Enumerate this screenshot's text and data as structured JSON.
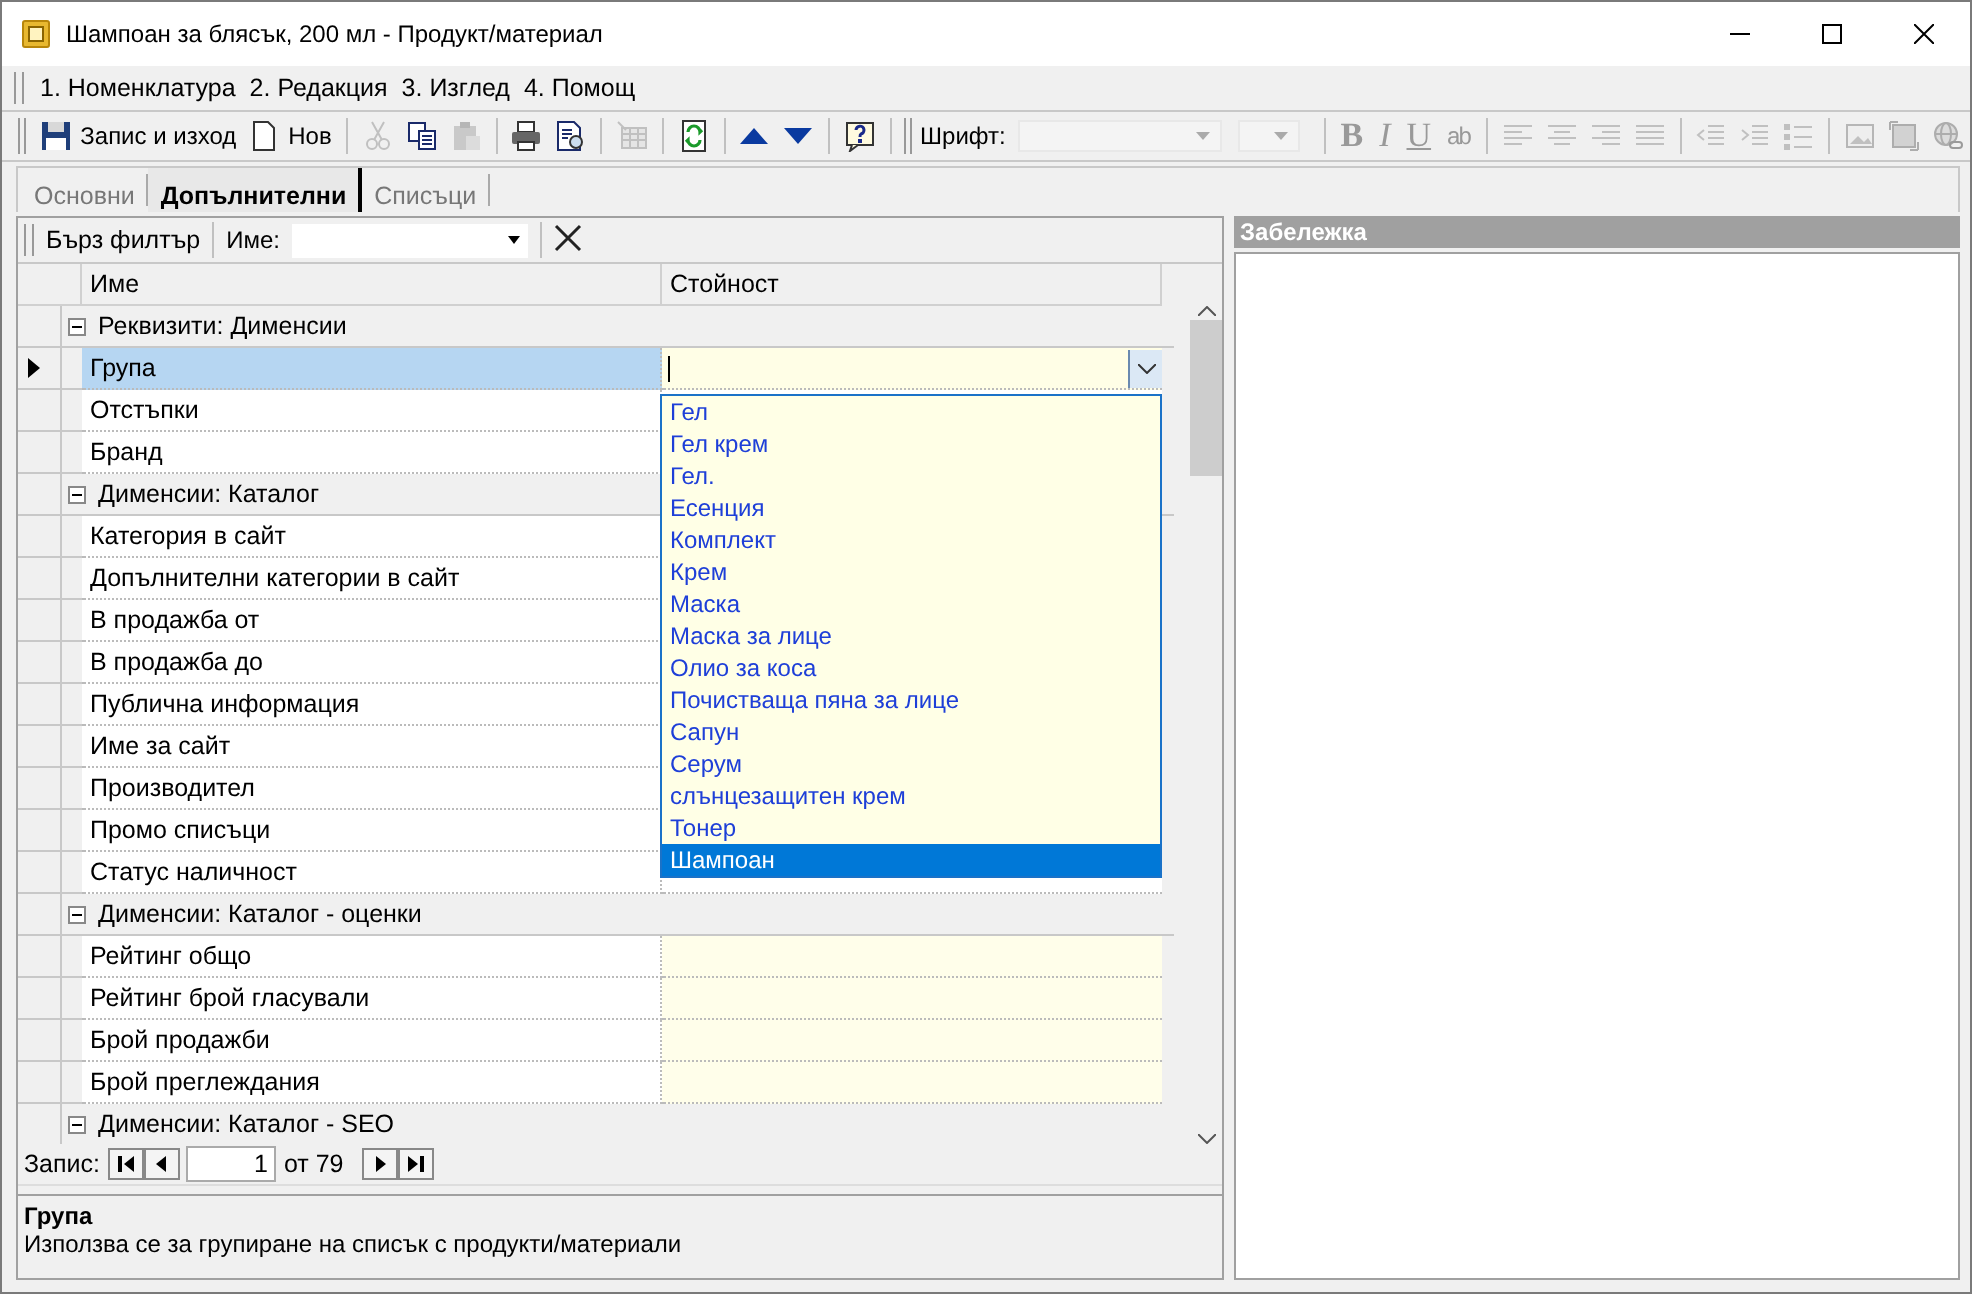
{
  "window": {
    "title": "Шампоан за блясък, 200 мл - Продукт/материал"
  },
  "menu": [
    {
      "label": "1. Номенклатура"
    },
    {
      "label": "2. Редакция"
    },
    {
      "label": "3. Изглед"
    },
    {
      "label": "4. Помощ"
    }
  ],
  "toolbar": [
    {
      "kind": "save",
      "label": "Запис и изход",
      "disabled": false
    },
    {
      "kind": "new",
      "label": "Нов",
      "disabled": false
    },
    {
      "kind": "sep"
    },
    {
      "kind": "cut",
      "disabled": true
    },
    {
      "kind": "copy",
      "disabled": false
    },
    {
      "kind": "paste",
      "disabled": true
    },
    {
      "kind": "sep"
    },
    {
      "kind": "print",
      "disabled": false
    },
    {
      "kind": "preview",
      "disabled": false
    },
    {
      "kind": "sep"
    },
    {
      "kind": "table",
      "disabled": true
    },
    {
      "kind": "sep"
    },
    {
      "kind": "refresh",
      "disabled": false
    },
    {
      "kind": "sep"
    },
    {
      "kind": "up",
      "disabled": false
    },
    {
      "kind": "down",
      "disabled": false
    },
    {
      "kind": "sep"
    },
    {
      "kind": "help",
      "disabled": false
    },
    {
      "kind": "grip"
    },
    {
      "kind": "label",
      "label": "Шрифт:"
    },
    {
      "kind": "combo",
      "disabled": true
    },
    {
      "kind": "combo",
      "disabled": true
    },
    {
      "kind": "sep"
    },
    {
      "kind": "bold",
      "label": "B",
      "disabled": true
    },
    {
      "kind": "italic",
      "label": "I",
      "disabled": true
    },
    {
      "kind": "underline",
      "label": "U",
      "disabled": true
    },
    {
      "kind": "strike",
      "label": "ab",
      "disabled": true
    },
    {
      "kind": "sep"
    },
    {
      "kind": "align-left",
      "disabled": true
    },
    {
      "kind": "align-center",
      "disabled": true
    },
    {
      "kind": "align-right",
      "disabled": true
    },
    {
      "kind": "align-justify",
      "disabled": true
    },
    {
      "kind": "sep"
    },
    {
      "kind": "outdent",
      "disabled": true
    },
    {
      "kind": "indent",
      "disabled": true
    },
    {
      "kind": "list",
      "disabled": true
    },
    {
      "kind": "sep"
    },
    {
      "kind": "image",
      "disabled": true
    },
    {
      "kind": "image-frame",
      "disabled": true
    },
    {
      "kind": "link",
      "disabled": true
    }
  ],
  "tabs": [
    {
      "label": "Основни",
      "selected": false
    },
    {
      "label": "Допълнителни",
      "selected": true
    },
    {
      "label": "Списъци",
      "selected": false
    }
  ],
  "filter": {
    "button": "Бърз филтър",
    "label": "Име:"
  },
  "grid": {
    "columns": [
      "Име",
      "Стойност"
    ],
    "rows": [
      {
        "kind": "group",
        "label": "Реквизити: Дименсии",
        "expanded": true
      },
      {
        "kind": "item",
        "name": "Група",
        "selected": true
      },
      {
        "kind": "item",
        "name": "Отстъпки",
        "selected": false
      },
      {
        "kind": "item",
        "name": "Бранд",
        "selected": false
      },
      {
        "kind": "group",
        "label": "Дименсии: Каталог",
        "expanded": true
      },
      {
        "kind": "item",
        "name": "Категория в сайт",
        "selected": false
      },
      {
        "kind": "item",
        "name": "Допълнителни категории в сайт",
        "selected": false
      },
      {
        "kind": "item",
        "name": "В продажба от",
        "selected": false
      },
      {
        "kind": "item",
        "name": "В продажба до",
        "selected": false
      },
      {
        "kind": "item",
        "name": "Публична информация",
        "selected": false
      },
      {
        "kind": "item",
        "name": "Име за сайт",
        "selected": false
      },
      {
        "kind": "item",
        "name": "Производител",
        "selected": false
      },
      {
        "kind": "item",
        "name": "Промо списъци",
        "selected": false
      },
      {
        "kind": "item",
        "name": "Статус наличност",
        "selected": false,
        "editable": false
      },
      {
        "kind": "group",
        "label": "Дименсии: Каталог - оценки",
        "expanded": true
      },
      {
        "kind": "item",
        "name": "Рейтинг общо",
        "selected": false,
        "editable": true
      },
      {
        "kind": "item",
        "name": "Рейтинг брой гласували",
        "selected": false,
        "editable": true
      },
      {
        "kind": "item",
        "name": "Брой продажби",
        "selected": false,
        "editable": true
      },
      {
        "kind": "item",
        "name": "Брой преглеждания",
        "selected": false,
        "editable": true
      },
      {
        "kind": "group",
        "label": "Дименсии: Каталог - SEO",
        "expanded": true
      }
    ],
    "dropdown": [
      {
        "label": "Гел",
        "selected": false
      },
      {
        "label": "Гел крем",
        "selected": false
      },
      {
        "label": "Гел.",
        "selected": false
      },
      {
        "label": "Есенция",
        "selected": false
      },
      {
        "label": "Комплект",
        "selected": false
      },
      {
        "label": "Крем",
        "selected": false
      },
      {
        "label": "Маска",
        "selected": false
      },
      {
        "label": "Маска за лице",
        "selected": false
      },
      {
        "label": "Олио за коса",
        "selected": false
      },
      {
        "label": "Почистваща пяна за лице",
        "selected": false
      },
      {
        "label": "Сапун",
        "selected": false
      },
      {
        "label": "Серум",
        "selected": false
      },
      {
        "label": "слънцезащитен крем",
        "selected": false
      },
      {
        "label": "Тонер",
        "selected": false
      },
      {
        "label": "Шампоан",
        "selected": true
      }
    ]
  },
  "navigator": {
    "label": "Запис:",
    "record": "1",
    "total": "от 79"
  },
  "description": {
    "title": "Група",
    "text": "Използва се за групиране на списък с продукти/материали"
  },
  "notes": {
    "title": "Забележка"
  }
}
